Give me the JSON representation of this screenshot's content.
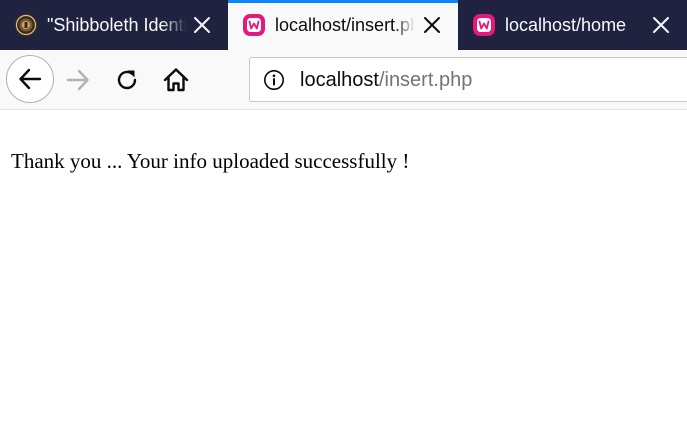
{
  "tabs": [
    {
      "title": "\"Shibboleth Identity Provider",
      "icon": "university-seal-icon",
      "active": false
    },
    {
      "title": "localhost/insert.php",
      "icon": "wampserver-icon",
      "active": true
    },
    {
      "title": "localhost/home",
      "icon": "wampserver-icon",
      "active": false
    }
  ],
  "toolbar": {
    "url_host": "localhost",
    "url_path": "/insert.php"
  },
  "page": {
    "message": "Thank you ... Your info uploaded successfully !"
  },
  "colors": {
    "tabstrip": "#202340",
    "active_tab": "#f9f9fa",
    "active_tab_accent": "#0a84ff",
    "wamp_pink": "#e5197d"
  }
}
